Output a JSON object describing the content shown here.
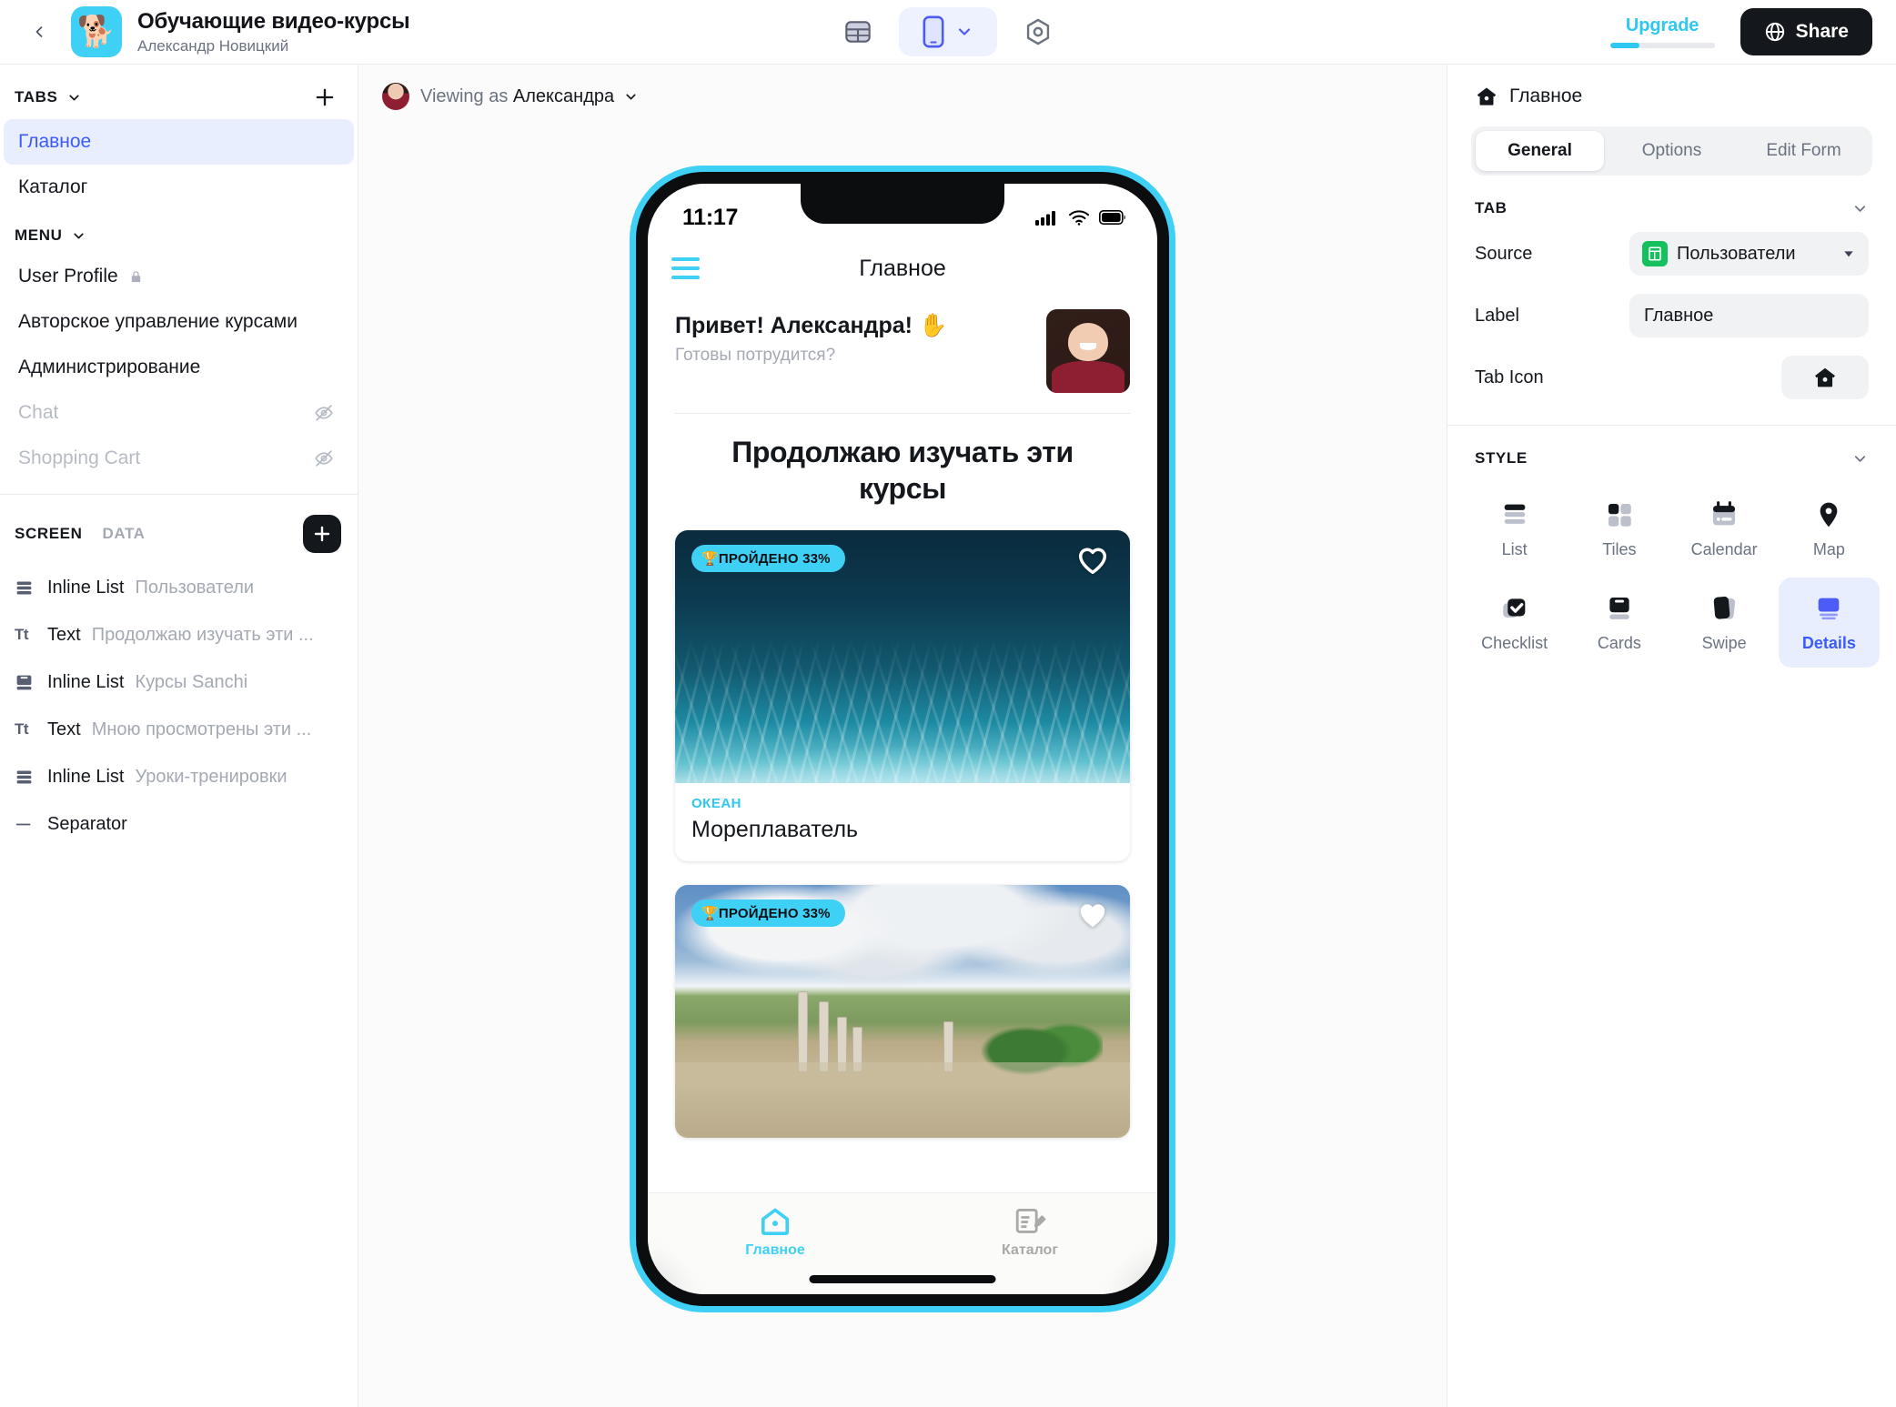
{
  "topbar": {
    "back_icon": "chevron-left-icon",
    "app_icon": "dog-avatar-icon",
    "app_emoji": "🐕",
    "title": "Обучающие видео-курсы",
    "subtitle": "Александр Новицкий",
    "tools": [
      {
        "name": "table-view-icon",
        "label": "Table"
      },
      {
        "name": "phone-preview-icon",
        "label": "Phone"
      },
      {
        "name": "settings-hex-icon",
        "label": "Settings"
      }
    ],
    "upgrade_label": "Upgrade",
    "upgrade_progress": 28,
    "share_label": "Share",
    "share_icon": "globe-icon",
    "accent": "#2ec8f0"
  },
  "sidebar": {
    "tabs_section": {
      "title": "TABS",
      "add_label": "+",
      "items": [
        {
          "label": "Главное",
          "active": true,
          "hidden": false,
          "locked": false
        },
        {
          "label": "Каталог",
          "active": false,
          "hidden": false,
          "locked": false
        }
      ]
    },
    "menu_section": {
      "title": "MENU",
      "items": [
        {
          "label": "User Profile",
          "active": false,
          "hidden": false,
          "locked": true
        },
        {
          "label": "Авторское управление курсами",
          "active": false,
          "hidden": false,
          "locked": false
        },
        {
          "label": "Администрирование",
          "active": false,
          "hidden": false,
          "locked": false
        },
        {
          "label": "Chat",
          "active": false,
          "hidden": true,
          "locked": false
        },
        {
          "label": "Shopping Cart",
          "active": false,
          "hidden": true,
          "locked": false
        }
      ]
    },
    "screen_section": {
      "tab_screen": "SCREEN",
      "tab_data": "DATA",
      "add_label": "+",
      "layers": [
        {
          "icon": "list-rows-icon",
          "type": "Inline List",
          "value": "Пользователи"
        },
        {
          "icon": "text-icon",
          "type": "Text",
          "value": "Продолжаю изучать эти ..."
        },
        {
          "icon": "cards-icon",
          "type": "Inline List",
          "value": "Курсы Sanchi"
        },
        {
          "icon": "text-icon",
          "type": "Text",
          "value": "Мною просмотрены эти ..."
        },
        {
          "icon": "list-rows-icon",
          "type": "Inline List",
          "value": "Уроки-тренировки"
        },
        {
          "icon": "separator-icon",
          "type": "Separator",
          "value": ""
        }
      ]
    }
  },
  "canvas": {
    "viewing_prefix": "Viewing as",
    "viewing_user": "Александра",
    "viewing_chevron": "chevron-down-icon"
  },
  "phone": {
    "status": {
      "time": "11:17",
      "signal_icon": "cellular-icon",
      "wifi_icon": "wifi-icon",
      "battery_icon": "battery-icon"
    },
    "navbar": {
      "menu_icon": "hamburger-menu-icon",
      "title": "Главное"
    },
    "greeting": {
      "heading": "Привет! Александра! ✋",
      "subtext": "Готовы потрудится?",
      "avatar": "user-photo"
    },
    "section_title": "Продолжаю изучать эти курсы",
    "cards": [
      {
        "badge": "🏆ПРОЙДЕНО 33%",
        "kicker": "ОКЕАН",
        "title": "Мореплаватель",
        "image": "ocean-underwater",
        "favorite_icon": "heart-outline-icon"
      },
      {
        "badge": "🏆ПРОЙДЕНО 33%",
        "kicker": "",
        "title": "",
        "image": "ancient-ruins",
        "favorite_icon": "heart-filled-icon"
      }
    ],
    "tabbar": [
      {
        "label": "Главное",
        "icon": "home-icon",
        "active": true
      },
      {
        "label": "Каталог",
        "icon": "catalog-edit-icon",
        "active": false
      }
    ],
    "frame_color": "#3fd0f5"
  },
  "inspector": {
    "header": {
      "icon": "home-icon",
      "title": "Главное"
    },
    "tabs": [
      {
        "label": "General",
        "active": true
      },
      {
        "label": "Options",
        "active": false
      },
      {
        "label": "Edit Form",
        "active": false
      }
    ],
    "tab_group": {
      "title": "TAB",
      "source_label": "Source",
      "source_value": "Пользователи",
      "source_icon": "google-sheet-icon",
      "label_label": "Label",
      "label_value": "Главное",
      "tab_icon_label": "Tab Icon",
      "tab_icon_value": "home-icon"
    },
    "style_group": {
      "title": "STYLE",
      "options": [
        {
          "label": "List",
          "icon": "style-list-icon",
          "active": false
        },
        {
          "label": "Tiles",
          "icon": "style-tiles-icon",
          "active": false
        },
        {
          "label": "Calendar",
          "icon": "style-calendar-icon",
          "active": false
        },
        {
          "label": "Map",
          "icon": "style-map-icon",
          "active": false
        },
        {
          "label": "Checklist",
          "icon": "style-checklist-icon",
          "active": false
        },
        {
          "label": "Cards",
          "icon": "style-cards-icon",
          "active": false
        },
        {
          "label": "Swipe",
          "icon": "style-swipe-icon",
          "active": false
        },
        {
          "label": "Details",
          "icon": "style-details-icon",
          "active": true
        }
      ]
    }
  }
}
